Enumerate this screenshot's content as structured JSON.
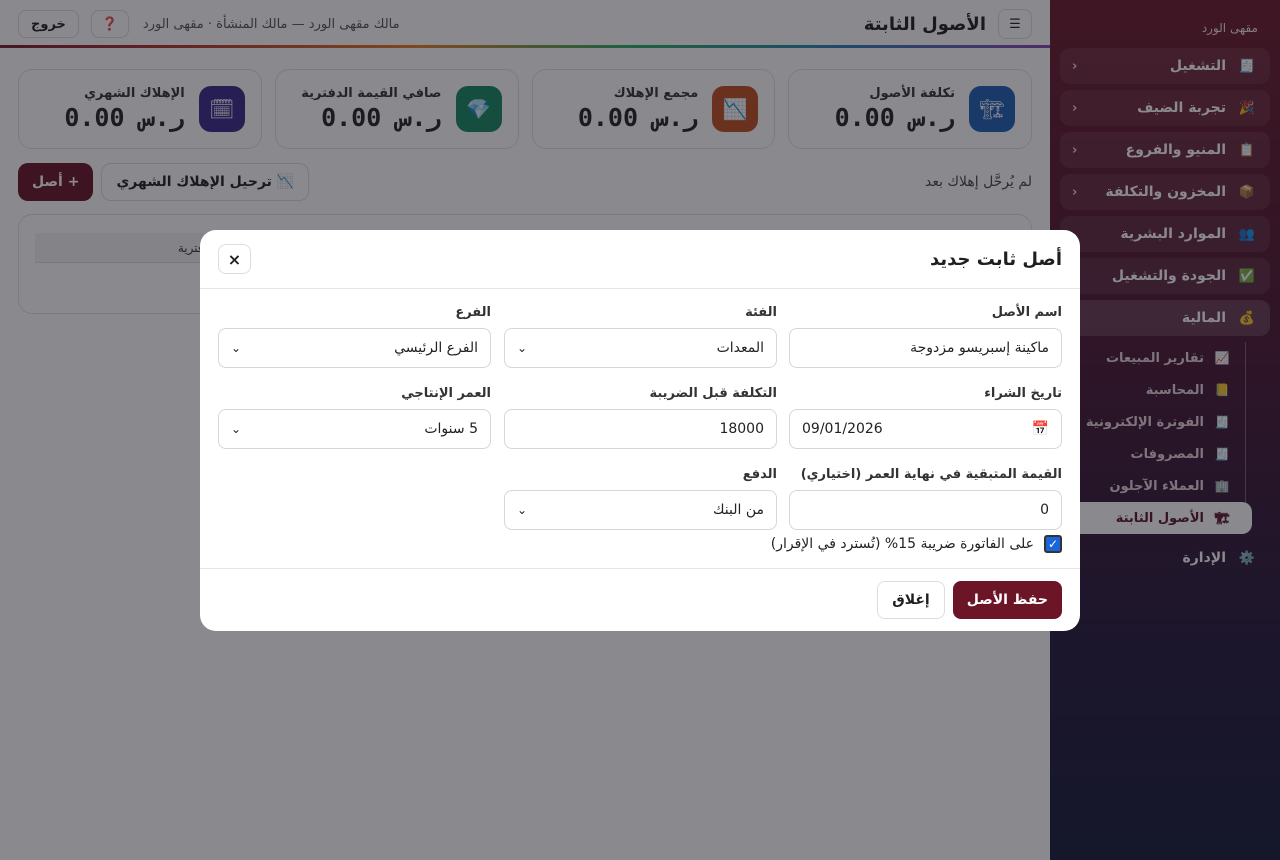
{
  "sidebar": {
    "brand": "مقهى الورد",
    "items": [
      {
        "icon": "🧾",
        "label": "التشغيل",
        "chevron": "‹"
      },
      {
        "icon": "🎉",
        "label": "تجربة الضيف",
        "chevron": "‹"
      },
      {
        "icon": "📋",
        "label": "المنيو والفروع",
        "chevron": "‹"
      },
      {
        "icon": "📦",
        "label": "المخزون والتكلفة",
        "chevron": "‹"
      },
      {
        "icon": "👥",
        "label": "الموارد البشرية"
      },
      {
        "icon": "✅",
        "label": "الجودة والتشغيل"
      },
      {
        "icon": "💰",
        "label": "المالية"
      }
    ],
    "finance_sub": [
      {
        "icon": "📈",
        "label": "تقارير المبيعات"
      },
      {
        "icon": "📒",
        "label": "المحاسبة"
      },
      {
        "icon": "🧾",
        "label": "الفوترة الإلكترونية"
      },
      {
        "icon": "🧾",
        "label": "المصروفات"
      },
      {
        "icon": "🏢",
        "label": "العملاء الآجلون"
      },
      {
        "icon": "🏗",
        "label": "الأصول الثابتة"
      }
    ],
    "admin": {
      "icon": "⚙️",
      "label": "الإدارة"
    }
  },
  "topbar": {
    "menu_icon": "☰",
    "title": "الأصول الثابتة",
    "owner": "مالك مقهى الورد — مالك المنشأة · مقهى الورد",
    "help": "❓",
    "logout": "خروج"
  },
  "cards": [
    {
      "icon": "🏗",
      "label": "تكلفة الأصول",
      "value": "ر.س 0.00",
      "color": "#1f5fb3"
    },
    {
      "icon": "📉",
      "label": "مجمع الإهلاك",
      "value": "ر.س 0.00",
      "color": "#c0501f"
    },
    {
      "icon": "💎",
      "label": "صافي القيمة الدفترية",
      "value": "ر.س 0.00",
      "color": "#17895e"
    },
    {
      "icon": "🗓",
      "label": "الإهلاك الشهري",
      "value": "ر.س 0.00",
      "color": "#3b2a8a"
    }
  ],
  "actions": {
    "not_posted": "لم يُرحَّل إهلاك بعد",
    "post_dep": "📉 ترحيل الإهلاك الشهري",
    "add_asset": "+ أصل"
  },
  "table": {
    "visible_header": "ة الدفترية"
  },
  "modal": {
    "title": "أصل ثابت جديد",
    "close_x": "×",
    "fields": {
      "asset_name": {
        "label": "اسم الأصل",
        "value": "ماكينة إسبريسو مزدوجة"
      },
      "category": {
        "label": "الفئة",
        "value": "المعدات"
      },
      "branch": {
        "label": "الفرع",
        "value": "الفرع الرئيسي"
      },
      "purchase_date": {
        "label": "تاريخ الشراء",
        "value": "09/01/2026"
      },
      "cost": {
        "label": "التكلفة قبل الضريبة",
        "value": "18000"
      },
      "life": {
        "label": "العمر الإنتاجي",
        "value": "5 سنوات"
      },
      "salvage": {
        "label": "القيمة المتبقية في نهاية العمر (اختياري)",
        "value": "0"
      },
      "payment": {
        "label": "الدفع",
        "value": "من البنك"
      }
    },
    "vat_label": "على الفاتورة ضريبة 15% (تُسترد في الإقرار)",
    "save": "حفظ الأصل",
    "close": "إغلاق"
  }
}
